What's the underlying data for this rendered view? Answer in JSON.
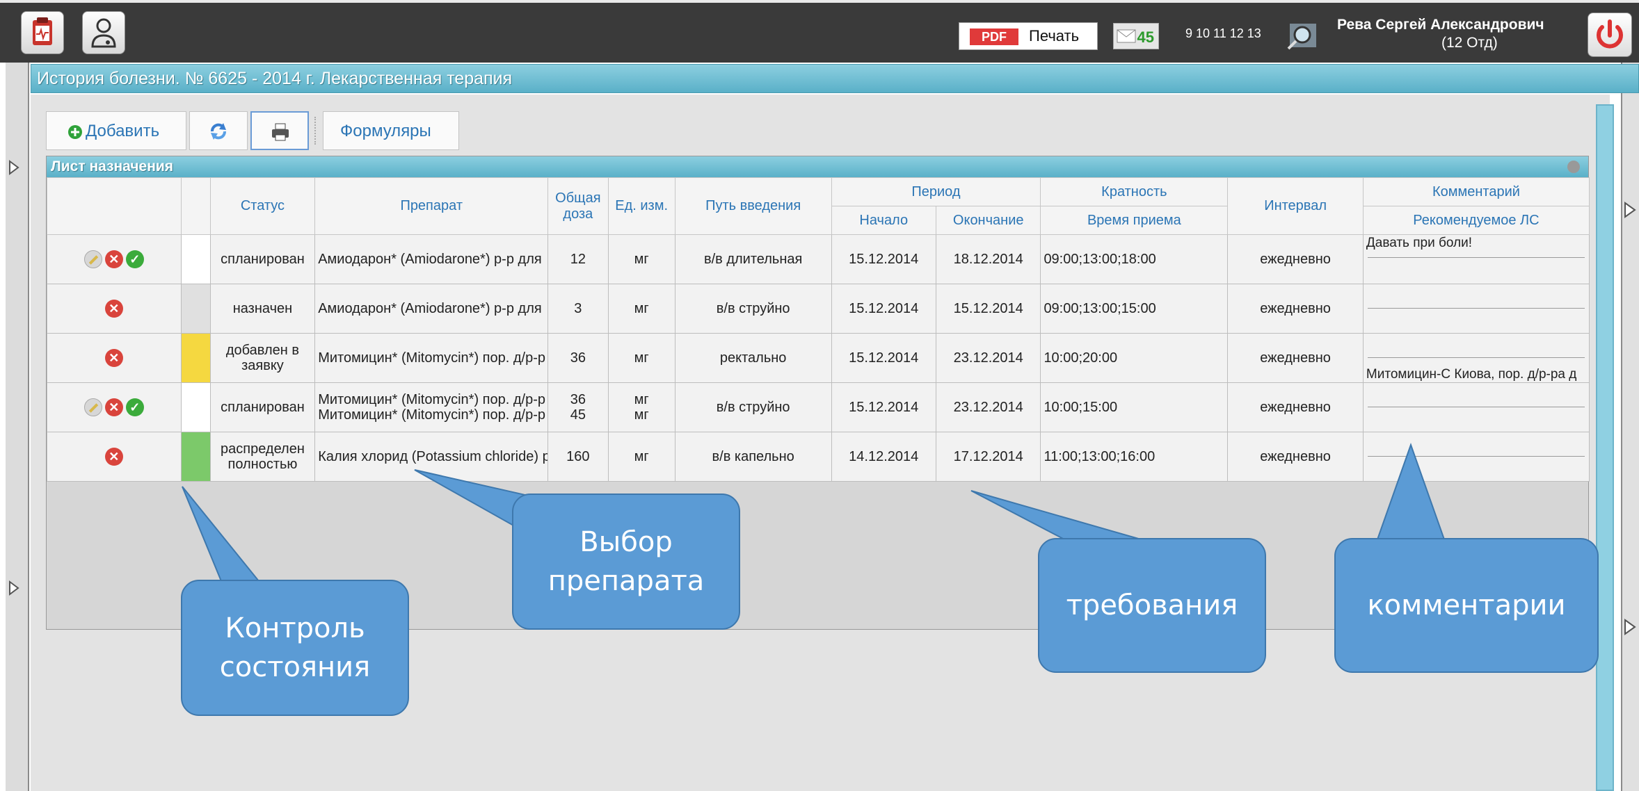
{
  "topbar": {
    "pdf_tag": "PDF",
    "print_label": "Печать",
    "mail_count": "45",
    "days": "9 10 11 12 13",
    "user_name": "Рева Сергей Александрович",
    "user_dept": "(12 Отд)"
  },
  "header": {
    "title": "История болезни. № 6625 - 2014 г. Лекарственная терапия"
  },
  "toolbar": {
    "add_label": "Добавить",
    "formulary_label": "Формуляры"
  },
  "sheet": {
    "title": "Лист назначения",
    "columns": {
      "status": "Статус",
      "drug": "Препарат",
      "total_dose": "Общая доза",
      "unit": "Ед. изм.",
      "route": "Путь введения",
      "period": "Период",
      "start": "Начало",
      "end": "Окончание",
      "frequency": "Кратность",
      "intake_time": "Время приема",
      "interval": "Интервал",
      "comment": "Комментарий",
      "recommended": "Рекомендуемое ЛС"
    },
    "rows": [
      {
        "status": "спланирован",
        "color": "#ffffff",
        "drug": "Амиодарон* (Amiodarone*) р-р для",
        "drug2": "",
        "dose": "12",
        "dose2": "",
        "unit": "мг",
        "unit2": "",
        "route": "в/в длительная",
        "start": "15.12.2014",
        "end": "18.12.2014",
        "times": "09:00;13:00;18:00",
        "interval": "ежедневно",
        "comment": "Давать при боли!",
        "recommended": ""
      },
      {
        "status": "назначен",
        "color": "#e0e0e0",
        "drug": "Амиодарон* (Amiodarone*) р-р для",
        "drug2": "",
        "dose": "3",
        "dose2": "",
        "unit": "мг",
        "unit2": "",
        "route": "в/в струйно",
        "start": "15.12.2014",
        "end": "15.12.2014",
        "times": "09:00;13:00;15:00",
        "interval": "ежедневно",
        "comment": "",
        "recommended": ""
      },
      {
        "status": "добавлен в заявку",
        "color": "#f5d840",
        "drug": "Митомицин* (Mitomycin*) пор. д/р-р",
        "drug2": "",
        "dose": "36",
        "dose2": "",
        "unit": "мг",
        "unit2": "",
        "route": "ректально",
        "start": "15.12.2014",
        "end": "23.12.2014",
        "times": "10:00;20:00",
        "interval": "ежедневно",
        "comment": "",
        "recommended": "Митомицин-С Киова, пор. д/р-ра д"
      },
      {
        "status": "спланирован",
        "color": "#ffffff",
        "drug": "Митомицин* (Mitomycin*) пор. д/р-р",
        "drug2": "Митомицин* (Mitomycin*) пор. д/р-р",
        "dose": "36",
        "dose2": "45",
        "unit": "мг",
        "unit2": "мг",
        "route": "в/в струйно",
        "start": "15.12.2014",
        "end": "23.12.2014",
        "times": "10:00;15:00",
        "interval": "ежедневно",
        "comment": "",
        "recommended": ""
      },
      {
        "status": "распределен полностью",
        "color": "#7cc96a",
        "drug": "Калия хлорид (Potassium chloride) р",
        "drug2": "",
        "dose": "160",
        "dose2": "",
        "unit": "мг",
        "unit2": "",
        "route": "в/в капельно",
        "start": "14.12.2014",
        "end": "17.12.2014",
        "times": "11:00;13:00;16:00",
        "interval": "ежедневно",
        "comment": "",
        "recommended": ""
      }
    ]
  },
  "callouts": {
    "state_control": "Контроль состояния",
    "drug_choice": "Выбор препарата",
    "requirements": "требования",
    "comments": "комментарии"
  },
  "colors": {
    "callout": "#5b9bd5",
    "header_blue": "#5ab0c8",
    "topbar": "#3a3a3a"
  }
}
